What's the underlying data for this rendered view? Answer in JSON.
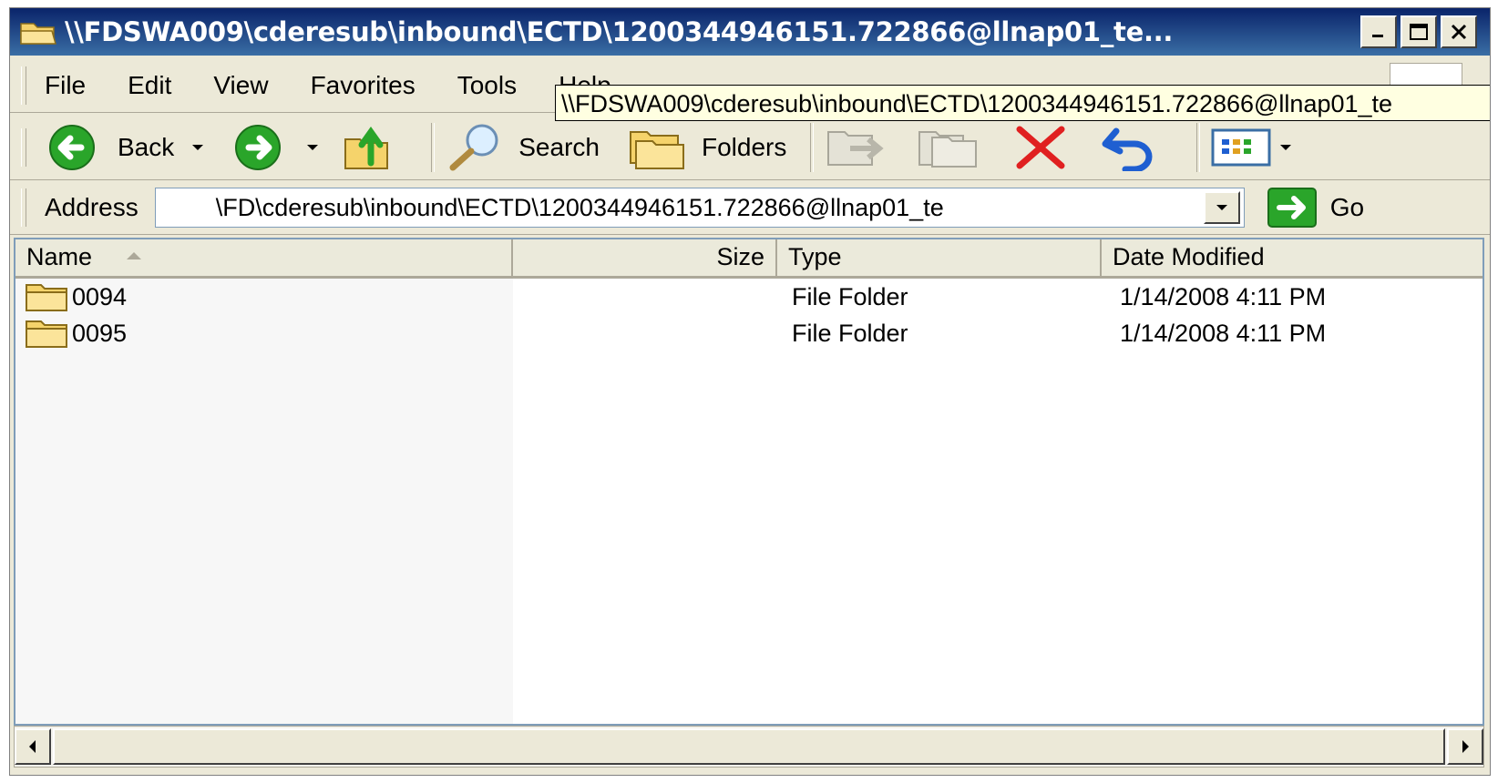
{
  "window": {
    "title": "\\\\FDSWA009\\cderesub\\inbound\\ECTD\\1200344946151.722866@llnap01_te..."
  },
  "menubar": {
    "items": [
      "File",
      "Edit",
      "View",
      "Favorites",
      "Tools",
      "Help"
    ]
  },
  "tooltip": {
    "text": "\\\\FDSWA009\\cderesub\\inbound\\ECTD\\1200344946151.722866@llnap01_te"
  },
  "toolbar": {
    "back_label": "Back",
    "search_label": "Search",
    "folders_label": "Folders"
  },
  "address": {
    "label": "Address",
    "value": "\\FD\\cderesub\\inbound\\ECTD\\1200344946151.722866@llnap01_te",
    "go_label": "Go"
  },
  "list": {
    "columns": [
      "Name",
      "Size",
      "Type",
      "Date Modified"
    ],
    "rows": [
      {
        "name": "0094",
        "size": "",
        "type": "File Folder",
        "date": "1/14/2008 4:11 PM"
      },
      {
        "name": "0095",
        "size": "",
        "type": "File Folder",
        "date": "1/14/2008 4:11 PM"
      }
    ]
  },
  "icons": {
    "title": "folder-open-icon",
    "back": "back-arrow-icon",
    "forward": "forward-arrow-icon",
    "up": "folder-up-icon",
    "search": "search-icon",
    "folders": "folders-icon",
    "move_to": "move-to-icon",
    "copy_to": "copy-to-icon",
    "delete": "delete-icon",
    "undo": "undo-icon",
    "views": "views-icon",
    "go": "go-arrow-icon",
    "row_folder": "folder-icon"
  },
  "colors": {
    "title_bar": "#0a246a",
    "window_bg": "#ece9d8",
    "tooltip_bg": "#ffffe1",
    "nav_green": "#2aa52a",
    "delete_red": "#e02020",
    "undo_blue": "#1f5fd1"
  }
}
